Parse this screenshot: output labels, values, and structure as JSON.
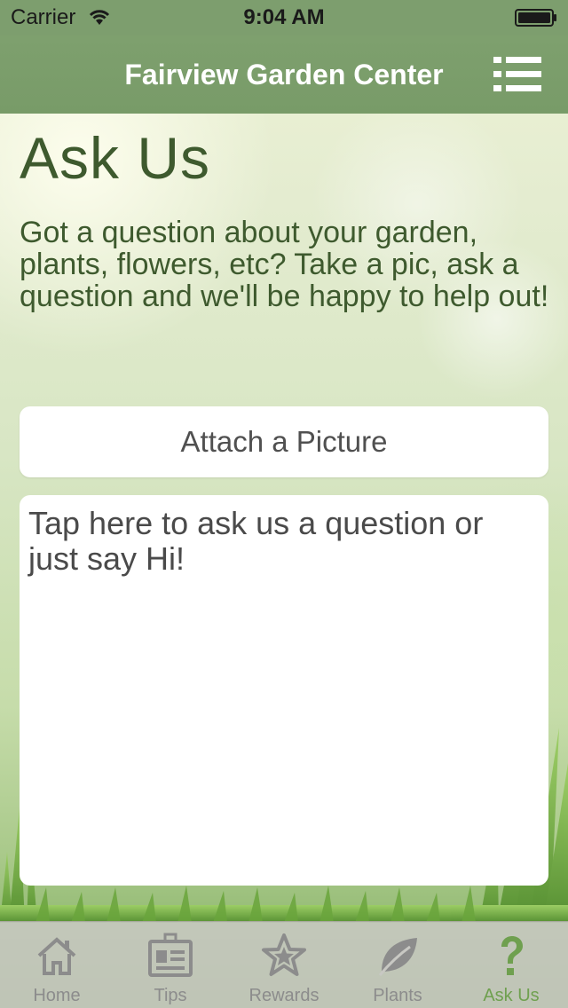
{
  "status_bar": {
    "carrier": "Carrier",
    "time": "9:04 AM"
  },
  "nav": {
    "title": "Fairview Garden Center",
    "menu_icon": "list-menu-icon"
  },
  "content": {
    "title": "Ask Us",
    "intro": "Got a question about your garden, plants, flowers, etc? Take a pic, ask a question and we'll be happy to help out!",
    "attach_label": "Attach a Picture",
    "question_placeholder": "Tap here to ask us a question or just say Hi!"
  },
  "tabs": [
    {
      "label": "Home",
      "icon": "home-icon"
    },
    {
      "label": "Tips",
      "icon": "id-card-icon"
    },
    {
      "label": "Rewards",
      "icon": "star-icon"
    },
    {
      "label": "Plants",
      "icon": "leaf-icon"
    },
    {
      "label": "Ask Us",
      "icon": "question-icon"
    }
  ],
  "active_tab": "Ask Us",
  "colors": {
    "nav_bar": "#7d9e6e",
    "heading_text": "#3e5a2e",
    "tab_active": "#6fa04f",
    "tab_inactive": "#8c8c8c"
  }
}
